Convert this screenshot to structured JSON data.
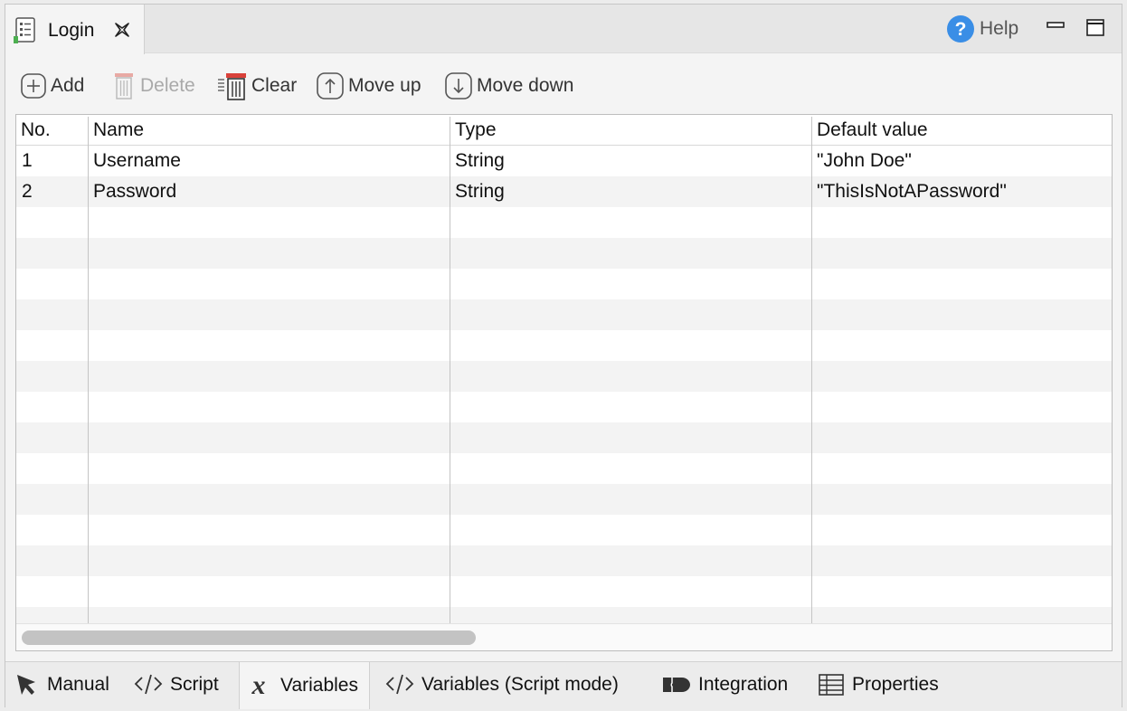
{
  "editor": {
    "tab_title": "Login",
    "help_label": "Help"
  },
  "toolbar": {
    "add": "Add",
    "delete": "Delete",
    "clear": "Clear",
    "move_up": "Move up",
    "move_down": "Move down"
  },
  "table": {
    "columns": [
      "No.",
      "Name",
      "Type",
      "Default value"
    ],
    "rows": [
      [
        "1",
        "Username",
        "String",
        "\"John Doe\""
      ],
      [
        "2",
        "Password",
        "String",
        "\"ThisIsNotAPassword\""
      ]
    ]
  },
  "bottom_tabs": {
    "manual": "Manual",
    "script": "Script",
    "variables": "Variables",
    "variables_script": "Variables (Script mode)",
    "integration": "Integration",
    "properties": "Properties",
    "active": "Variables"
  },
  "icons": {
    "tab": "variables-list-icon",
    "close": "close-icon",
    "help": "help-icon",
    "minimize": "minimize-icon",
    "maximize": "maximize-icon",
    "add": "add-icon",
    "delete": "trash-icon",
    "clear": "clear-icon",
    "move_up": "arrow-up-icon",
    "move_down": "arrow-down-icon"
  },
  "colors": {
    "help_accent": "#3a8ee6",
    "clear_accent": "#d9413a"
  }
}
